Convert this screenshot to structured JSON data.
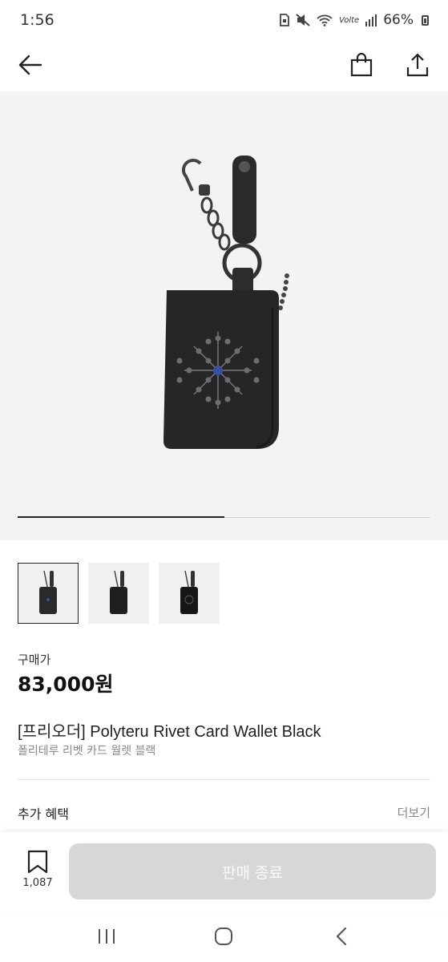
{
  "status_bar": {
    "time": "1:56",
    "carrier": "Volte",
    "battery": "66%",
    "icons": [
      "sim-icon",
      "mute-icon",
      "wifi-icon",
      "signal-icon",
      "battery-icon"
    ]
  },
  "app_bar": {
    "icons": [
      "back-arrow-icon",
      "shopping-bag-icon",
      "share-icon"
    ]
  },
  "gallery": {
    "progress": 0.5,
    "thumbnails": [
      {
        "label": "thumb-1",
        "active": true
      },
      {
        "label": "thumb-2",
        "active": false
      },
      {
        "label": "thumb-3",
        "active": false
      }
    ]
  },
  "product": {
    "price_label": "구매가",
    "price": "83,000원",
    "title": "[프리오더] Polyteru Rivet Card Wallet Black",
    "subtitle": "폴리테루 리벳 카드 월렛 블랙"
  },
  "benefits": {
    "label": "추가 혜택",
    "more": "더보기"
  },
  "bottom_bar": {
    "bookmark_count": "1,087",
    "cta_label": "판매 종료"
  },
  "nav": {
    "icons": [
      "recent-apps-icon",
      "home-icon",
      "back-icon"
    ]
  },
  "colors": {
    "accent": "#222222",
    "disabled_button": "#d7d7d7",
    "hero_bg": "#f3f3f3"
  }
}
